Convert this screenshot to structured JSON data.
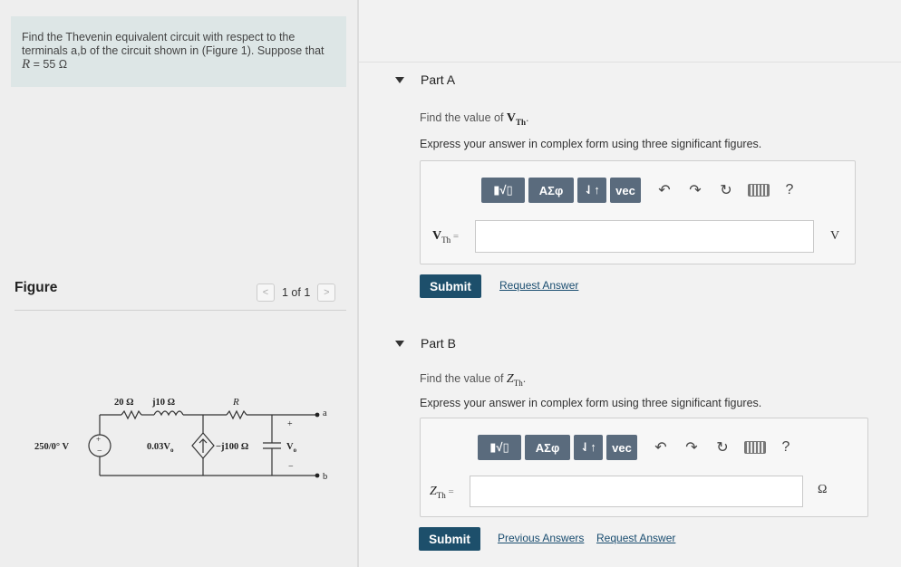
{
  "problem": {
    "text_before": "Find the Thevenin equivalent circuit with respect to the terminals a,b of the circuit shown in (Figure 1). Suppose that ",
    "r_var": "R",
    "r_value": " = 55 Ω"
  },
  "figure": {
    "label": "Figure",
    "pager_text": "1 of 1",
    "prev_glyph": "<",
    "next_glyph": ">"
  },
  "circuit": {
    "source_label": "250/0° V",
    "r1_label": "20 Ω",
    "x1_label": "j10 Ω",
    "r_label": "R",
    "dep_label": "0.03V",
    "dep_sub": "o",
    "cap_label": "−j100 Ω",
    "vo_label": "V",
    "vo_sub": "o",
    "term_a": "a",
    "term_b": "b",
    "plus": "+",
    "minus": "−"
  },
  "partA": {
    "title": "Part A",
    "prompt_prefix": "Find the value of ",
    "var_main": "V",
    "var_sub": "Th",
    "prompt_suffix": ".",
    "instruction": "Express your answer in complex form using three significant figures.",
    "toolbar": {
      "templates": "▮√▯",
      "greek": "ΑΣφ",
      "arrows": "⇃↑",
      "vec": "vec"
    },
    "input_label_main": "V",
    "input_label_sub": "Th",
    "input_eq": " =",
    "input_value": "",
    "unit": "V",
    "submit": "Submit",
    "links": [
      "Request Answer"
    ]
  },
  "partB": {
    "title": "Part B",
    "prompt_prefix": "Find the value of ",
    "var_main": "Z",
    "var_sub": "Th",
    "prompt_suffix": ".",
    "instruction": "Express your answer in complex form using three significant figures.",
    "toolbar": {
      "templates": "▮√▯",
      "greek": "ΑΣφ",
      "arrows": "⇃↑",
      "vec": "vec"
    },
    "input_label_main": "Z",
    "input_label_sub": "Th",
    "input_eq": " =",
    "input_value": "",
    "unit": "Ω",
    "submit": "Submit",
    "links": [
      "Previous Answers",
      "Request Answer"
    ]
  },
  "icons": [
    "undo-icon",
    "redo-icon",
    "reset-icon",
    "keyboard-icon",
    "help-icon",
    "collapse-triangle-icon"
  ]
}
